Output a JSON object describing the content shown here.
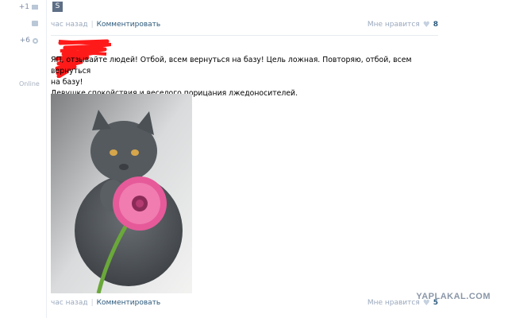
{
  "left_column": {
    "counter1": "+1",
    "counter2": "+6"
  },
  "top_post": {
    "thumb_letter": "S",
    "time": "час назад",
    "comment_label": "Комментировать",
    "like_label": "Мне нравится",
    "like_count": "8"
  },
  "post": {
    "status": "Online",
    "line1": "ЯП, отзывайте людей! Отбой, всем вернуться на базу! Цель ложная. Повторяю, отбой, всем вернуться",
    "line2": "на базу!",
    "line3": "Девушке спокойствия и веселого порицания лжедоносителей.",
    "time": "час назад",
    "comment_label": "Комментировать",
    "like_label": "Мне нравится",
    "like_count": "5"
  },
  "watermark": "YAPLAKAL.COM",
  "icons": {
    "mail": "envelope-icon",
    "comment": "comment-icon",
    "settings": "gear-icon",
    "heart": "heart-icon"
  },
  "colors": {
    "link": "#2b587a",
    "muted": "#9aa9bd",
    "redaction": "#ff0000"
  }
}
